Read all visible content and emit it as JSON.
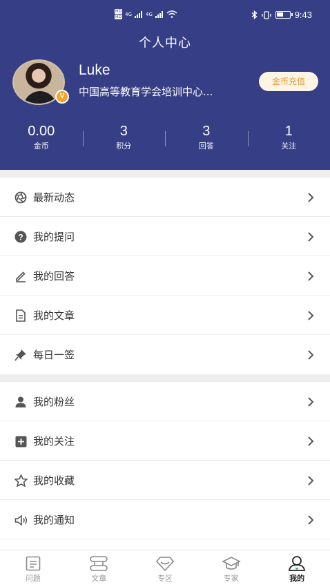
{
  "status_bar": {
    "time": "9:43",
    "network": "4G"
  },
  "page_title": "个人中心",
  "profile": {
    "name": "Luke",
    "organization": "中国高等教育学会培训中心...",
    "badge": "V",
    "recharge_button": "金币充值"
  },
  "stats": [
    {
      "value": "0.00",
      "label": "金币"
    },
    {
      "value": "3",
      "label": "积分"
    },
    {
      "value": "3",
      "label": "回答"
    },
    {
      "value": "1",
      "label": "关注"
    }
  ],
  "menu_group_1": [
    {
      "label": "最新动态",
      "icon": "camera-aperture-icon"
    },
    {
      "label": "我的提问",
      "icon": "question-icon"
    },
    {
      "label": "我的回答",
      "icon": "pencil-icon"
    },
    {
      "label": "我的文章",
      "icon": "document-icon"
    },
    {
      "label": "每日一签",
      "icon": "pin-icon"
    }
  ],
  "menu_group_2": [
    {
      "label": "我的粉丝",
      "icon": "person-icon"
    },
    {
      "label": "我的关注",
      "icon": "plus-square-icon"
    },
    {
      "label": "我的收藏",
      "icon": "star-icon"
    },
    {
      "label": "我的通知",
      "icon": "speaker-icon"
    }
  ],
  "tabs": [
    {
      "label": "问题",
      "icon": "question-list-icon"
    },
    {
      "label": "文章",
      "icon": "article-icon"
    },
    {
      "label": "专区",
      "icon": "diamond-icon"
    },
    {
      "label": "专家",
      "icon": "graduation-cap-icon"
    },
    {
      "label": "我的",
      "icon": "user-icon",
      "active": true
    }
  ],
  "colors": {
    "header_bg": "#363E86",
    "accent": "#E39B2A"
  }
}
